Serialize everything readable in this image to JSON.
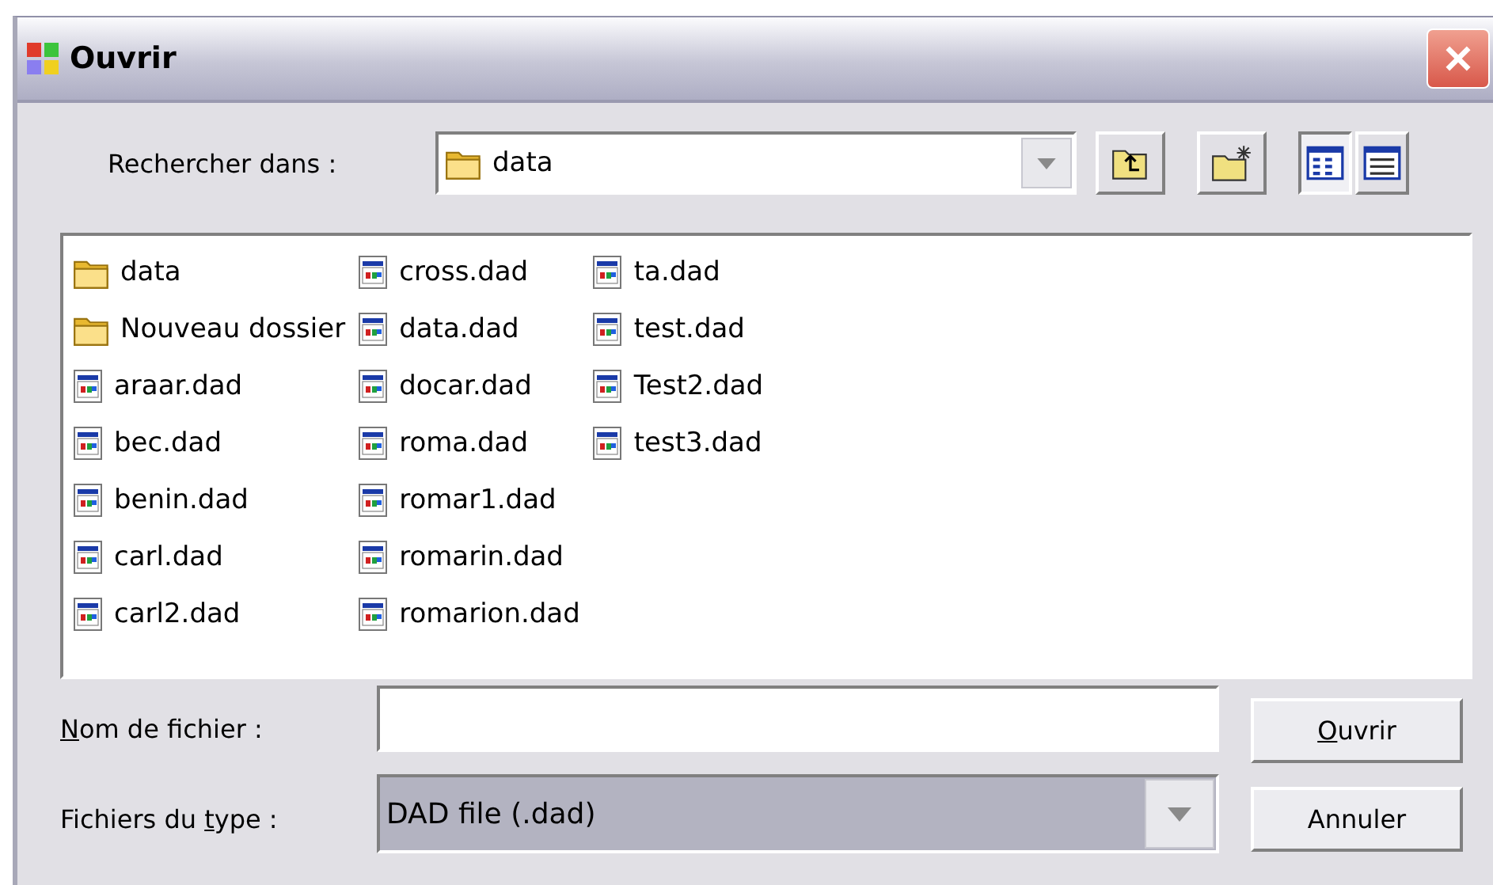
{
  "window": {
    "title": "Ouvrir"
  },
  "look_in": {
    "label": "Rechercher dans :",
    "value": "data"
  },
  "toolbar": [
    {
      "kind": "up"
    },
    {
      "kind": "new-folder"
    },
    {
      "kind": "list-view",
      "selected": true
    },
    {
      "kind": "details-view",
      "selected": false
    }
  ],
  "files": [
    {
      "name": "data",
      "kind": "folder"
    },
    {
      "name": "Nouveau dossier",
      "kind": "folder"
    },
    {
      "name": "araar.dad",
      "kind": "file"
    },
    {
      "name": "bec.dad",
      "kind": "file"
    },
    {
      "name": "benin.dad",
      "kind": "file"
    },
    {
      "name": "carl.dad",
      "kind": "file"
    },
    {
      "name": "carl2.dad",
      "kind": "file"
    },
    {
      "name": "cross.dad",
      "kind": "file"
    },
    {
      "name": "data.dad",
      "kind": "file"
    },
    {
      "name": "docar.dad",
      "kind": "file"
    },
    {
      "name": "roma.dad",
      "kind": "file"
    },
    {
      "name": "romar1.dad",
      "kind": "file"
    },
    {
      "name": "romarin.dad",
      "kind": "file"
    },
    {
      "name": "romarion.dad",
      "kind": "file"
    },
    {
      "name": "ta.dad",
      "kind": "file"
    },
    {
      "name": "test.dad",
      "kind": "file"
    },
    {
      "name": "Test2.dad",
      "kind": "file"
    },
    {
      "name": "test3.dad",
      "kind": "file"
    }
  ],
  "file_name": {
    "label": [
      {
        "text": "N",
        "underlined": true
      },
      {
        "text": "om de fichier :",
        "underlined": false
      }
    ]
  },
  "file_type": {
    "label": [
      {
        "text": "Fichiers du ",
        "underlined": false
      },
      {
        "text": "t",
        "underlined": true
      },
      {
        "text": "ype :",
        "underlined": false
      }
    ],
    "value": "DAD file (.dad)"
  },
  "buttons": [
    {
      "label": [
        {
          "text": "O",
          "underlined": true
        },
        {
          "text": "uvrir",
          "underlined": false
        }
      ]
    },
    {
      "label": [
        {
          "text": "Annuler",
          "underlined": false
        }
      ]
    }
  ]
}
